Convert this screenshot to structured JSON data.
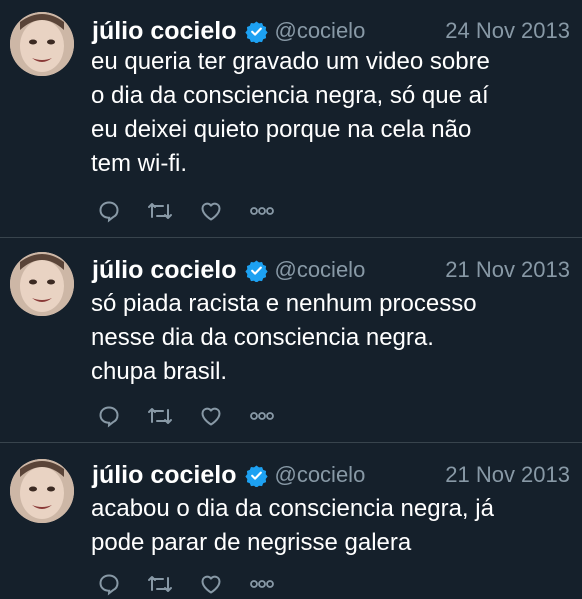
{
  "colors": {
    "background": "#15202b",
    "divider": "#38444d",
    "text": "#ffffff",
    "secondary_text": "#8899a6",
    "verified_badge": "#1da1f2"
  },
  "tweets": [
    {
      "author_name": "júlio cocielo",
      "handle": "@cocielo",
      "date": "24 Nov 2013",
      "text": "eu queria ter gravado um video sobre\no dia da consciencia negra, só que aí\neu deixei quieto porque na cela não\ntem wi-fi.",
      "actions": [
        "reply-icon",
        "retweet-icon",
        "like-icon",
        "more-icon"
      ]
    },
    {
      "author_name": "júlio cocielo",
      "handle": "@cocielo",
      "date": "21 Nov 2013",
      "text": "só piada racista e nenhum processo\nnesse dia da consciencia negra.\nchupa brasil.",
      "actions": [
        "reply-icon",
        "retweet-icon",
        "like-icon",
        "more-icon"
      ]
    },
    {
      "author_name": "júlio cocielo",
      "handle": "@cocielo",
      "date": "21 Nov 2013",
      "text": "acabou o dia da consciencia negra, já\npode parar de negrisse galera",
      "actions": [
        "reply-icon",
        "retweet-icon",
        "like-icon",
        "more-icon"
      ]
    }
  ]
}
